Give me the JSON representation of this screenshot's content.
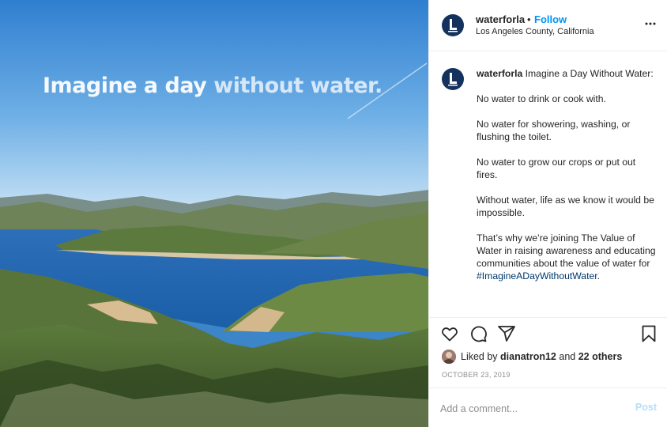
{
  "image": {
    "overlay_part1": "Imagine a day ",
    "overlay_part2": "without water."
  },
  "header": {
    "username": "waterforla",
    "separator": "•",
    "follow_label": "Follow",
    "location": "Los Angeles County, California",
    "more_icon": "more-horizontal-icon"
  },
  "caption": {
    "username": "waterforla",
    "first_line": " Imagine a Day Without Water:",
    "paragraphs": [
      "No water to drink or cook with.",
      "No water for showering, washing, or flushing the toilet.",
      "No water to grow our crops or put out fires.",
      "Without water, life as we know it would be impossible."
    ],
    "last_paragraph": "That’s why we’re joining The Value of Water in raising awareness and educating communities about the value of water for ",
    "hashtag": "#ImagineADayWithoutWater",
    "trailing": "."
  },
  "actions": {
    "icons": [
      "heart-icon",
      "comment-icon",
      "share-icon",
      "bookmark-icon"
    ]
  },
  "likes": {
    "prefix": "Liked by ",
    "user": "dianatron12",
    "middle": " and ",
    "others": "22 others"
  },
  "date": "OCTOBER 23, 2019",
  "comment": {
    "placeholder": "Add a comment...",
    "post_label": "Post"
  },
  "colors": {
    "accent": "#0095f6",
    "post_disabled": "#b2dffc",
    "avatar_bg": "#15325f"
  }
}
